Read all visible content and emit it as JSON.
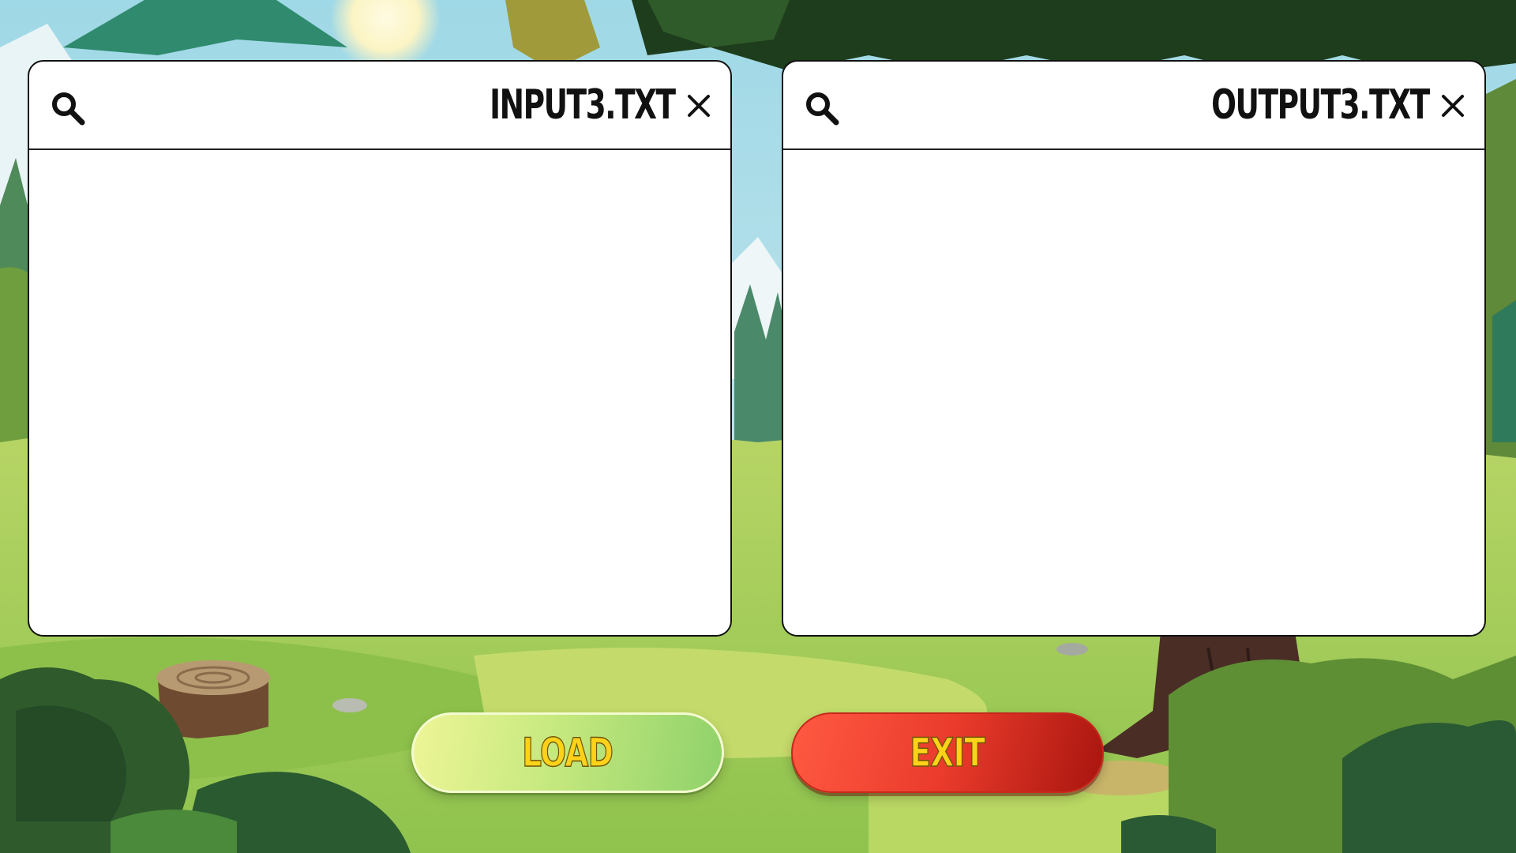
{
  "input_panel": {
    "filename": "INPUT3.TXT",
    "search_icon": "search-icon",
    "close_icon": "close-icon"
  },
  "output_panel": {
    "filename": "OUTPUT3.TXT",
    "search_icon": "search-icon",
    "close_icon": "close-icon"
  },
  "buttons": {
    "load_label": "LOAD",
    "exit_label": "EXIT"
  },
  "colors": {
    "load_button": "#b5e277",
    "exit_button": "#e23a2a",
    "button_text": "#ffd21a"
  }
}
